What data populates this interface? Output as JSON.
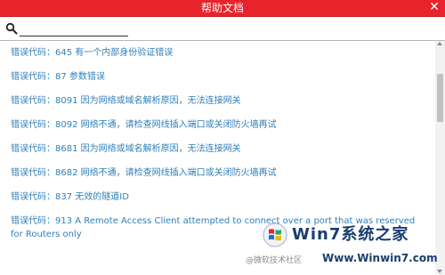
{
  "window": {
    "title": "帮助文档",
    "close_glyph": "✕"
  },
  "search": {
    "value": "",
    "placeholder": ""
  },
  "errors": [
    "错误代码：645 有一个内部身份验证错误",
    "错误代码：87 参数错误",
    "错误代码：8091 因为网络或域名解析原因，无法连接网关",
    "错误代码：8092 网络不通，请检查网线插入端口或关闭防火墙再试",
    "错误代码：8681 因为网络或域名解析原因，无法连接网关",
    "错误代码：8682 网络不通，请检查网线插入端口或关闭防火墙再试",
    "错误代码：837 无效的隧道ID",
    "错误代码：913 A Remote Access Client attempted to connect over a port that was reserved for Routers only"
  ],
  "watermark": {
    "brand": "Win7系统之家",
    "wechat": "@微软技术社区",
    "domain": "Www.Winwin7.com"
  },
  "colors": {
    "titlebar": "#e8232b",
    "link_text": "#2f7fb8",
    "brand": "#1b3d6e"
  }
}
